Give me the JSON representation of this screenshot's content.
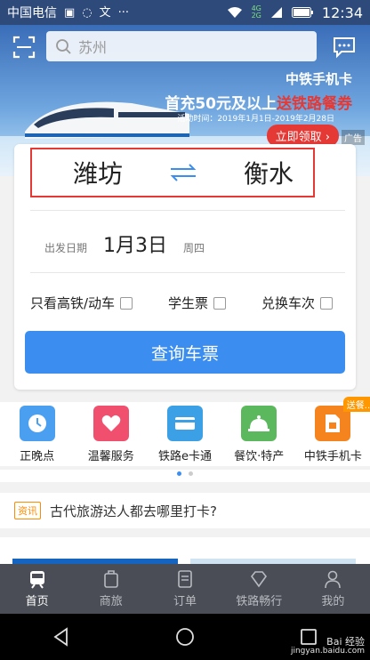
{
  "status_bar": {
    "carrier": "中国电信",
    "time": "12:34",
    "network": "4G",
    "network2": "2G"
  },
  "search": {
    "placeholder": "苏州"
  },
  "banner": {
    "promo_title": "中铁手机卡",
    "promo_main_prefix": "首充50元及以上",
    "promo_main_highlight": "送铁路餐券",
    "promo_date": "活动时间：2019年1月1日-2019年2月28日",
    "promo_button": "立即领取 ›",
    "ad_tag": "广告"
  },
  "booking": {
    "from_station": "潍坊",
    "to_station": "衡水",
    "date_label": "出发日期",
    "date_value": "1月3日",
    "weekday": "周四",
    "options": [
      {
        "label": "只看高铁/动车"
      },
      {
        "label": "学生票"
      },
      {
        "label": "兑换车次"
      }
    ],
    "query_button": "查询车票"
  },
  "services": [
    {
      "label": "正晚点",
      "color": "#4a9ff0",
      "icon": "clock-icon"
    },
    {
      "label": "温馨服务",
      "color": "#f0506e",
      "icon": "heart-icon"
    },
    {
      "label": "铁路e卡通",
      "color": "#3ba0e6",
      "icon": "card-icon"
    },
    {
      "label": "餐饮·特产",
      "color": "#5cb85c",
      "icon": "bell-icon"
    },
    {
      "label": "中铁手机卡",
      "color": "#f5841f",
      "icon": "sim-icon",
      "badge": "送餐..."
    }
  ],
  "news": {
    "tag": "资讯",
    "text": "古代旅游达人都去哪里打卡?"
  },
  "tabs": [
    {
      "label": "首页",
      "active": true
    },
    {
      "label": "商旅"
    },
    {
      "label": "订单"
    },
    {
      "label": "铁路畅行"
    },
    {
      "label": "我的"
    }
  ],
  "watermark": {
    "line1": "Bai 经验",
    "line2": "jingyan.baidu.com"
  },
  "colors": {
    "accent": "#3b8ef0",
    "highlight_border": "#e53935",
    "tabbar": "#4a4d55"
  }
}
